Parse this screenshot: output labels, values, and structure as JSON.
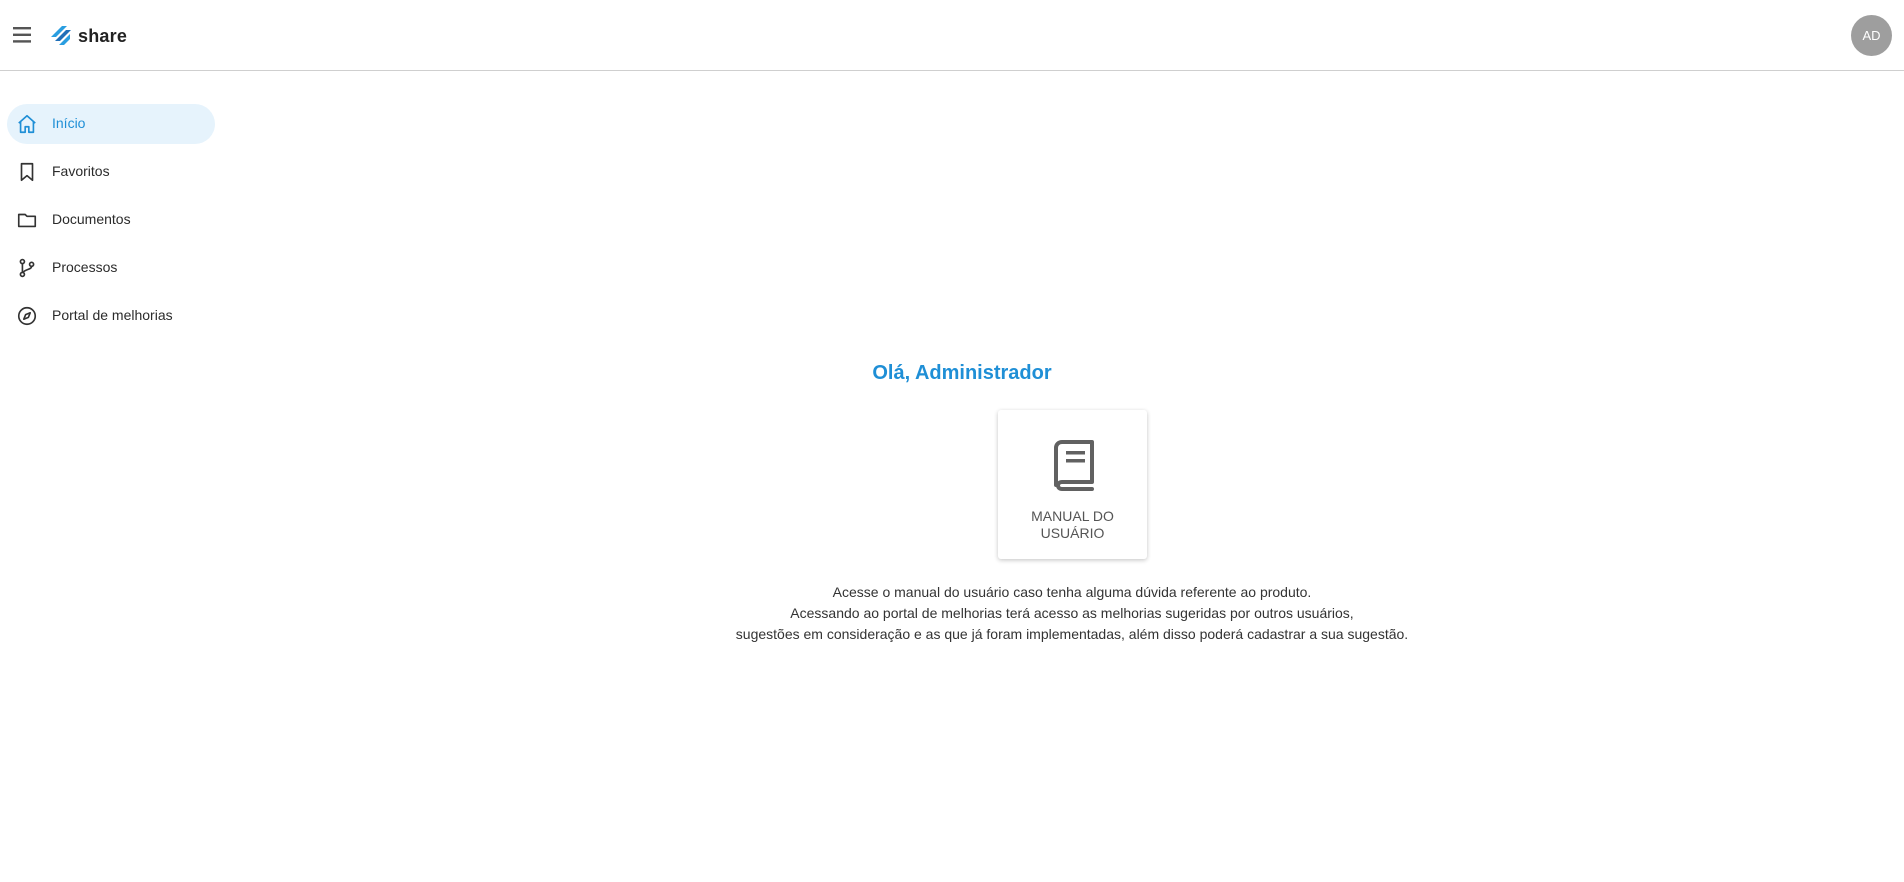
{
  "header": {
    "logo_text": "share",
    "avatar_initials": "AD",
    "colors": {
      "brand": "#1f8fd6",
      "avatar_bg": "#9e9e9e",
      "border": "#cfcfcf"
    }
  },
  "sidebar": {
    "items": [
      {
        "label": "Início",
        "icon": "home-icon",
        "active": true
      },
      {
        "label": "Favoritos",
        "icon": "bookmark-icon",
        "active": false
      },
      {
        "label": "Documentos",
        "icon": "folder-icon",
        "active": false
      },
      {
        "label": "Processos",
        "icon": "git-branch-icon",
        "active": false
      },
      {
        "label": "Portal de melhorias",
        "icon": "compass-icon",
        "active": false
      }
    ],
    "colors": {
      "active_bg": "#e6f3fc",
      "active_text": "#1f8fd6"
    }
  },
  "main": {
    "greeting": "Olá, Administrador",
    "manual_card": {
      "label": "MANUAL DO USUÁRIO",
      "icon": "book-icon"
    },
    "description": [
      "Acesse o manual do usuário caso tenha alguma dúvida referente ao produto.",
      "Acessando ao portal de melhorias terá acesso as melhorias sugeridas por outros usuários,",
      "sugestões em consideração e as que já foram implementadas, além disso poderá cadastrar a sua sugestão."
    ]
  }
}
